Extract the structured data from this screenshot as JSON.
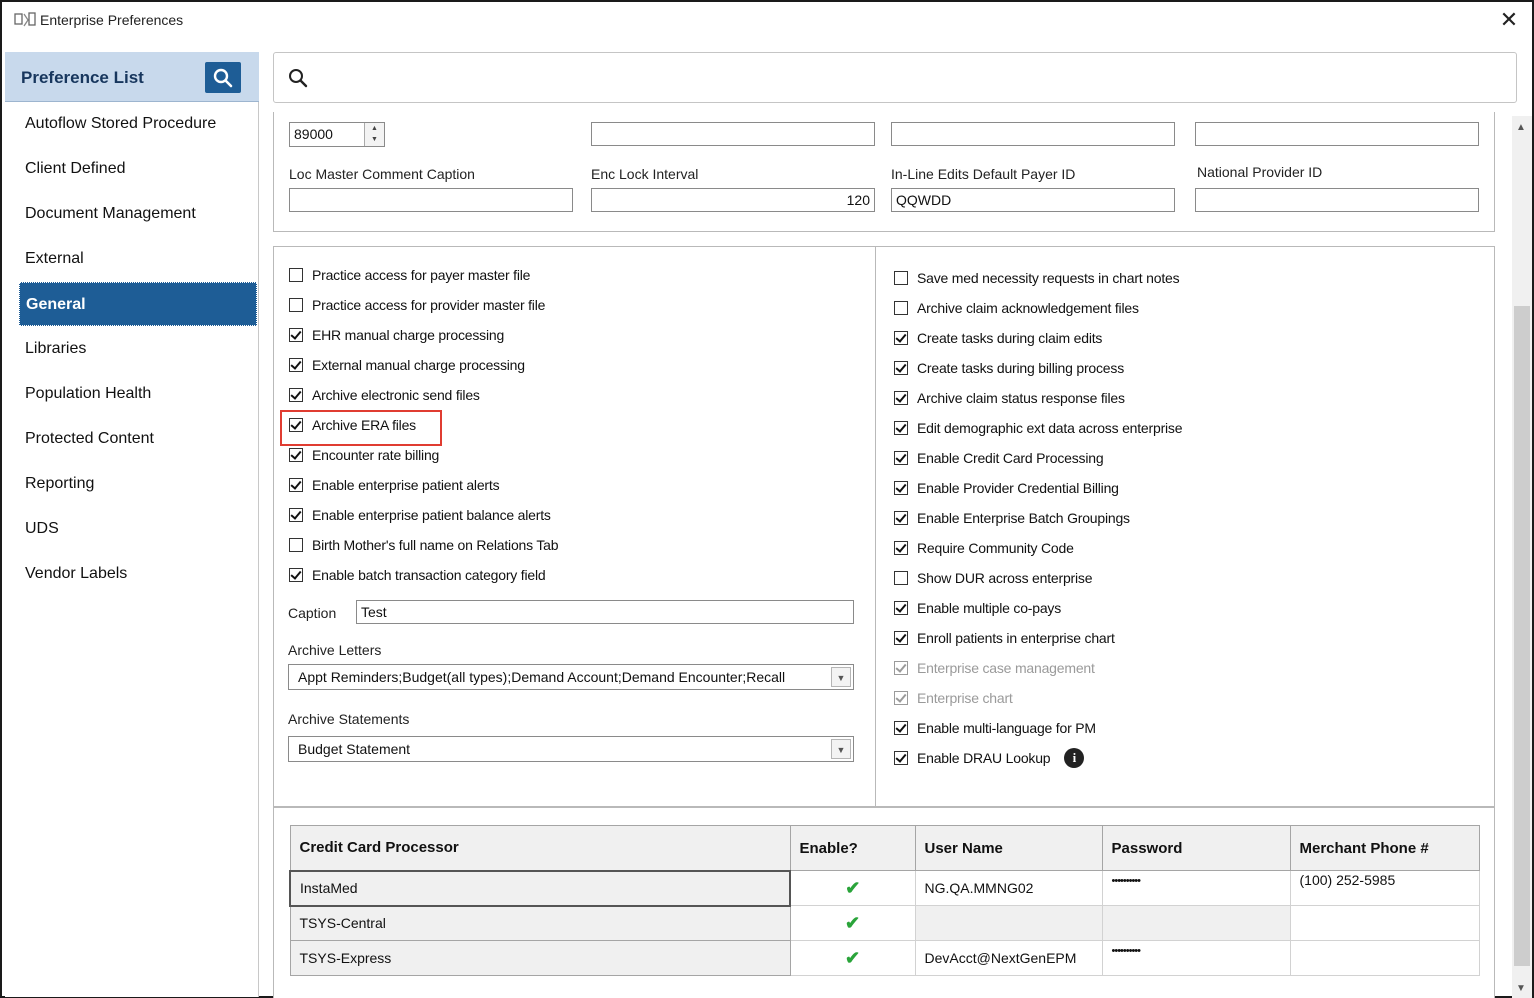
{
  "window": {
    "title": "Enterprise Preferences",
    "app_icon": "preferences-app-icon",
    "close_label": "✕"
  },
  "sidebar": {
    "header": "Preference List",
    "items": [
      {
        "label": "Autoflow Stored Procedure",
        "active": false
      },
      {
        "label": "Client Defined",
        "active": false
      },
      {
        "label": "Document Management",
        "active": false
      },
      {
        "label": "External",
        "active": false
      },
      {
        "label": "General",
        "active": true
      },
      {
        "label": "Libraries",
        "active": false
      },
      {
        "label": "Population Health",
        "active": false
      },
      {
        "label": "Protected Content",
        "active": false
      },
      {
        "label": "Reporting",
        "active": false
      },
      {
        "label": "UDS",
        "active": false
      },
      {
        "label": "Vendor Labels",
        "active": false
      }
    ]
  },
  "search": {
    "placeholder": "",
    "value": ""
  },
  "top_fields": {
    "spinner_value": "89000",
    "row1_values": [
      "",
      "",
      ""
    ],
    "loc_master_label": "Loc Master Comment Caption",
    "loc_master_value": "",
    "enc_lock_label": "Enc Lock Interval",
    "enc_lock_value": "120",
    "inline_edits_label": "In-Line Edits Default Payer ID",
    "inline_edits_value": "QQWDD",
    "npi_label": "National Provider ID",
    "npi_value": ""
  },
  "left_checks": [
    {
      "label": "Practice access for payer master file",
      "checked": false
    },
    {
      "label": "Practice access for provider master file",
      "checked": false
    },
    {
      "label": "EHR manual charge processing",
      "checked": true
    },
    {
      "label": "External manual charge processing",
      "checked": true
    },
    {
      "label": "Archive electronic send files",
      "checked": true
    },
    {
      "label": "Archive ERA files",
      "checked": true,
      "highlighted": true
    },
    {
      "label": "Encounter rate billing",
      "checked": true
    },
    {
      "label": "Enable enterprise patient alerts",
      "checked": true
    },
    {
      "label": "Enable enterprise patient balance alerts",
      "checked": true
    },
    {
      "label": "Birth Mother's full name on Relations Tab",
      "checked": false
    },
    {
      "label": "Enable batch transaction category field",
      "checked": true
    }
  ],
  "caption": {
    "label": "Caption",
    "value": "Test"
  },
  "archive_letters": {
    "label": "Archive Letters",
    "value": "Appt Reminders;Budget(all types);Demand Account;Demand Encounter;Recall"
  },
  "archive_statements": {
    "label": "Archive Statements",
    "value": "Budget Statement"
  },
  "right_checks": [
    {
      "label": "Save med necessity requests in chart notes",
      "checked": false,
      "disabled": false
    },
    {
      "label": "Archive claim acknowledgement files",
      "checked": false,
      "disabled": false
    },
    {
      "label": "Create tasks during claim edits",
      "checked": true,
      "disabled": false
    },
    {
      "label": "Create tasks during billing process",
      "checked": true,
      "disabled": false
    },
    {
      "label": "Archive claim status response files",
      "checked": true,
      "disabled": false
    },
    {
      "label": "Edit demographic ext data across enterprise",
      "checked": true,
      "disabled": false
    },
    {
      "label": "Enable Credit Card Processing",
      "checked": true,
      "disabled": false
    },
    {
      "label": "Enable Provider Credential Billing",
      "checked": true,
      "disabled": false
    },
    {
      "label": "Enable Enterprise Batch Groupings",
      "checked": true,
      "disabled": false
    },
    {
      "label": "Require Community Code",
      "checked": true,
      "disabled": false
    },
    {
      "label": "Show DUR across enterprise",
      "checked": false,
      "disabled": false
    },
    {
      "label": "Enable multiple co-pays",
      "checked": true,
      "disabled": false
    },
    {
      "label": "Enroll patients in enterprise chart",
      "checked": true,
      "disabled": false
    },
    {
      "label": "Enterprise case management",
      "checked": true,
      "disabled": true
    },
    {
      "label": "Enterprise chart",
      "checked": true,
      "disabled": true
    },
    {
      "label": "Enable multi-language for PM",
      "checked": true,
      "disabled": false
    },
    {
      "label": "Enable DRAU Lookup",
      "checked": true,
      "disabled": false,
      "info_icon": "i"
    }
  ],
  "cc_table": {
    "headers": [
      "Credit Card Processor",
      "Enable?",
      "User Name",
      "Password",
      "Merchant Phone #"
    ],
    "rows": [
      {
        "processor": "InstaMed",
        "enabled": "✔",
        "user": "NG.QA.MMNG02",
        "password": "••••••••••",
        "phone": "(100) 252-5985"
      },
      {
        "processor": "TSYS-Central",
        "enabled": "✔",
        "user": "",
        "password": "",
        "phone": ""
      },
      {
        "processor": "TSYS-Express",
        "enabled": "✔",
        "user": "DevAcct@NextGenEPM",
        "password": "••••••••••",
        "phone": ""
      }
    ]
  },
  "colors": {
    "accent": "#1e5d96",
    "header_bg": "#c8d9ec",
    "highlight": "#e03c31",
    "check_green": "#2aa43a"
  }
}
